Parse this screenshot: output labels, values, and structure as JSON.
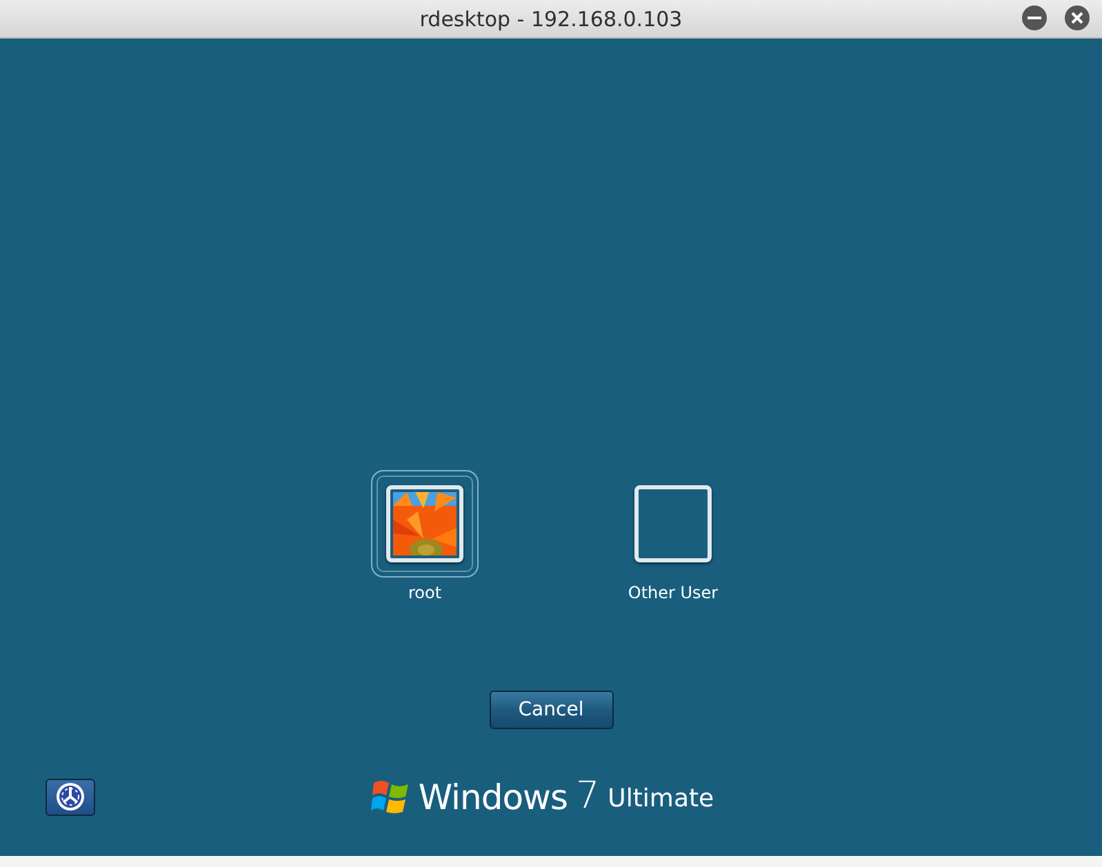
{
  "window": {
    "title": "rdesktop - 192.168.0.103"
  },
  "users": [
    {
      "name": "root",
      "selected": true,
      "kind": "picture"
    },
    {
      "name": "Other User",
      "selected": false,
      "kind": "blank"
    }
  ],
  "cancel_button": "Cancel",
  "branding": {
    "product": "Windows",
    "version": "7",
    "edition": "Ultimate"
  }
}
